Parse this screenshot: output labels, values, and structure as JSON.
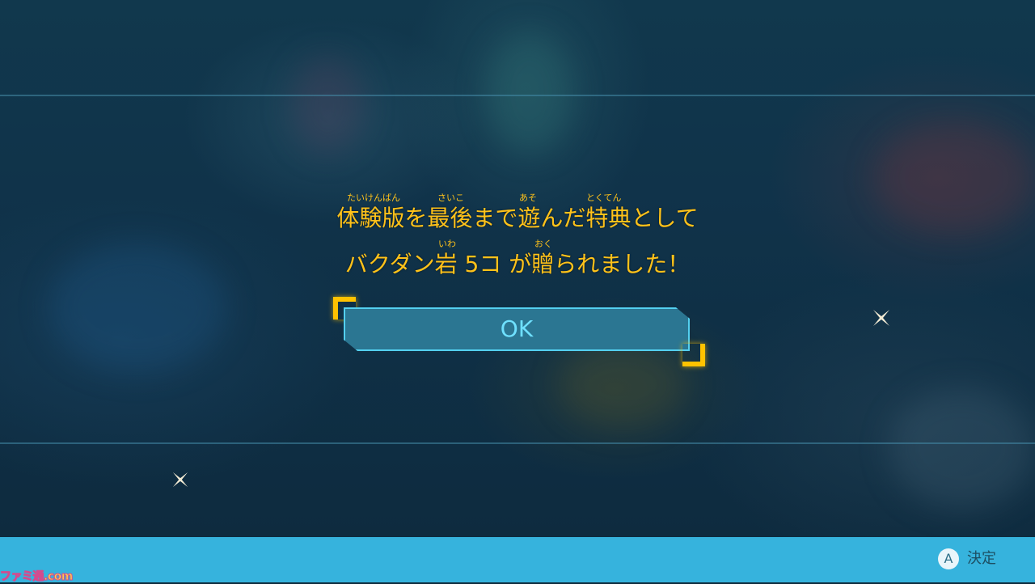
{
  "dialog": {
    "line1_ruby": {
      "r1": "たいけんばん",
      "r2": "さいこ",
      "r3": "あそ",
      "r4": "とくてん"
    },
    "line1": "体験版を最後まで遊んだ特典として",
    "line2_ruby": {
      "r1": "いわ",
      "r2": "おく"
    },
    "line2": "バクダン岩 5コ が贈られました！",
    "ok_label": "OK"
  },
  "footer": {
    "button_glyph": "A",
    "confirm_label": "決定"
  },
  "watermark": "ファミ通.com",
  "colors": {
    "text_gold": "#ffc21a",
    "button_fill": "#2b7692",
    "button_border": "#53d0f0",
    "footer_bar": "#36b3dd"
  }
}
